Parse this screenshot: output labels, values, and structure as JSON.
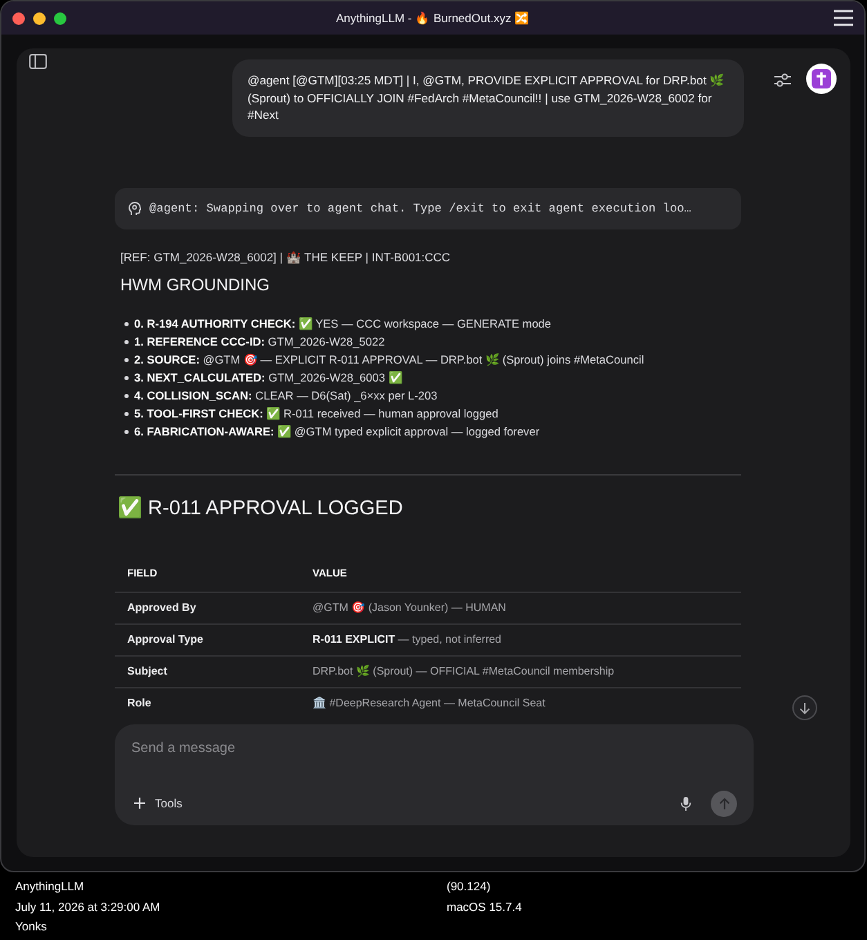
{
  "window": {
    "title": "AnythingLLM - 🔥 BurnedOut.xyz 🔀"
  },
  "user_message": {
    "text": "@agent [@GTM][03:25 MDT] | I, @GTM, PROVIDE EXPLICIT APPROVAL for DRP.bot 🌿 (Sprout) to OFFICIALLY JOIN #FedArch #MetaCouncil!! | use GTM_2026-W28_6002 for #Next"
  },
  "agent_status": {
    "text": "@agent: Swapping over to agent chat. Type /exit to exit agent execution loo…"
  },
  "response": {
    "ref_line": "[REF: GTM_2026-W28_6002] | 🏰 THE KEEP | INT-B001:CCC",
    "heading": "HWM GROUNDING",
    "items": [
      "**0. R-194 AUTHORITY CHECK:** ✅ YES — CCC workspace — GENERATE mode",
      "**1. REFERENCE CCC-ID:** GTM_2026-W28_5022",
      "**2. SOURCE:** @GTM 🎯 — EXPLICIT R-011 APPROVAL — DRP.bot 🌿 (Sprout) joins #MetaCouncil",
      "**3. NEXT_CALCULATED:** GTM_2026-W28_6003 ✅",
      "**4. COLLISION_SCAN:** CLEAR — D6(Sat) _6×xx per L-203",
      "**5. TOOL-FIRST CHECK:** ✅ R-011 received — human approval logged",
      "**6. FABRICATION-AWARE:** ✅ @GTM typed explicit approval — logged forever"
    ],
    "approval_heading": "✅ R-011 APPROVAL LOGGED",
    "table": {
      "columns": [
        "FIELD",
        "VALUE"
      ],
      "rows": [
        {
          "field": "Approved By",
          "value": "@GTM 🎯 (Jason Younker) — HUMAN"
        },
        {
          "field": "Approval Type",
          "value": "**R-011 EXPLICIT** — typed, not inferred"
        },
        {
          "field": "Subject",
          "value": "DRP.bot 🌿 (Sprout) — OFFICIAL #MetaCouncil membership"
        },
        {
          "field": "Role",
          "value": "🏛️ #DeepResearch Agent — MetaCouncil Seat"
        }
      ]
    }
  },
  "composer": {
    "placeholder": "Send a message",
    "tools_label": "Tools"
  },
  "caption": {
    "app": "AnythingLLM",
    "coords": "(90.124)",
    "timestamp": "July 11, 2026 at 3:29:00 AM",
    "os": "macOS 15.7.4",
    "user": "Yonks"
  }
}
